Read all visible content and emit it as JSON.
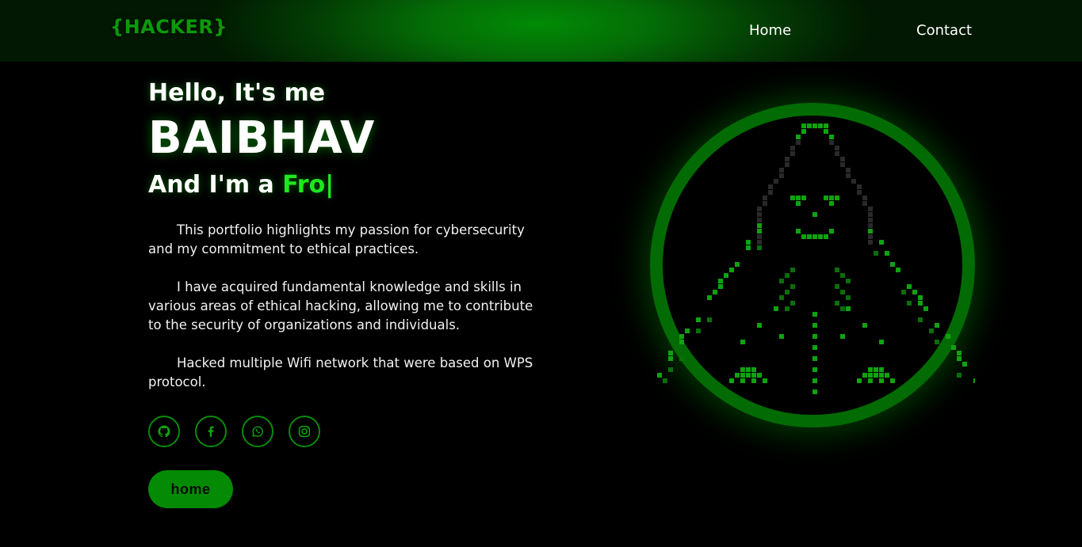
{
  "header": {
    "logo": "{HACKER}",
    "nav": [
      {
        "label": "Home"
      },
      {
        "label": "Contact"
      }
    ]
  },
  "hero": {
    "greeting": "Hello, It's me",
    "name": "BAIBHAV",
    "role_prefix": "And I'm a ",
    "role_typed": "Fro",
    "cursor": "|",
    "paragraphs": [
      "This portfolio highlights my passion for cybersecurity and my commitment to ethical practices.",
      "I have acquired fundamental knowledge and skills in various areas of ethical hacking, allowing me to contribute to the security of organizations and individuals.",
      "Hacked multiple Wifi network that were based on WPS protocol."
    ],
    "socials": [
      {
        "icon": "github-icon"
      },
      {
        "icon": "facebook-icon"
      },
      {
        "icon": "whatsapp-icon"
      },
      {
        "icon": "instagram-icon"
      }
    ],
    "button_label": "home"
  },
  "colors": {
    "accent": "#1ee81e",
    "header_green": "#028a05",
    "button_green": "#048a04",
    "ring_green": "#036b03"
  }
}
